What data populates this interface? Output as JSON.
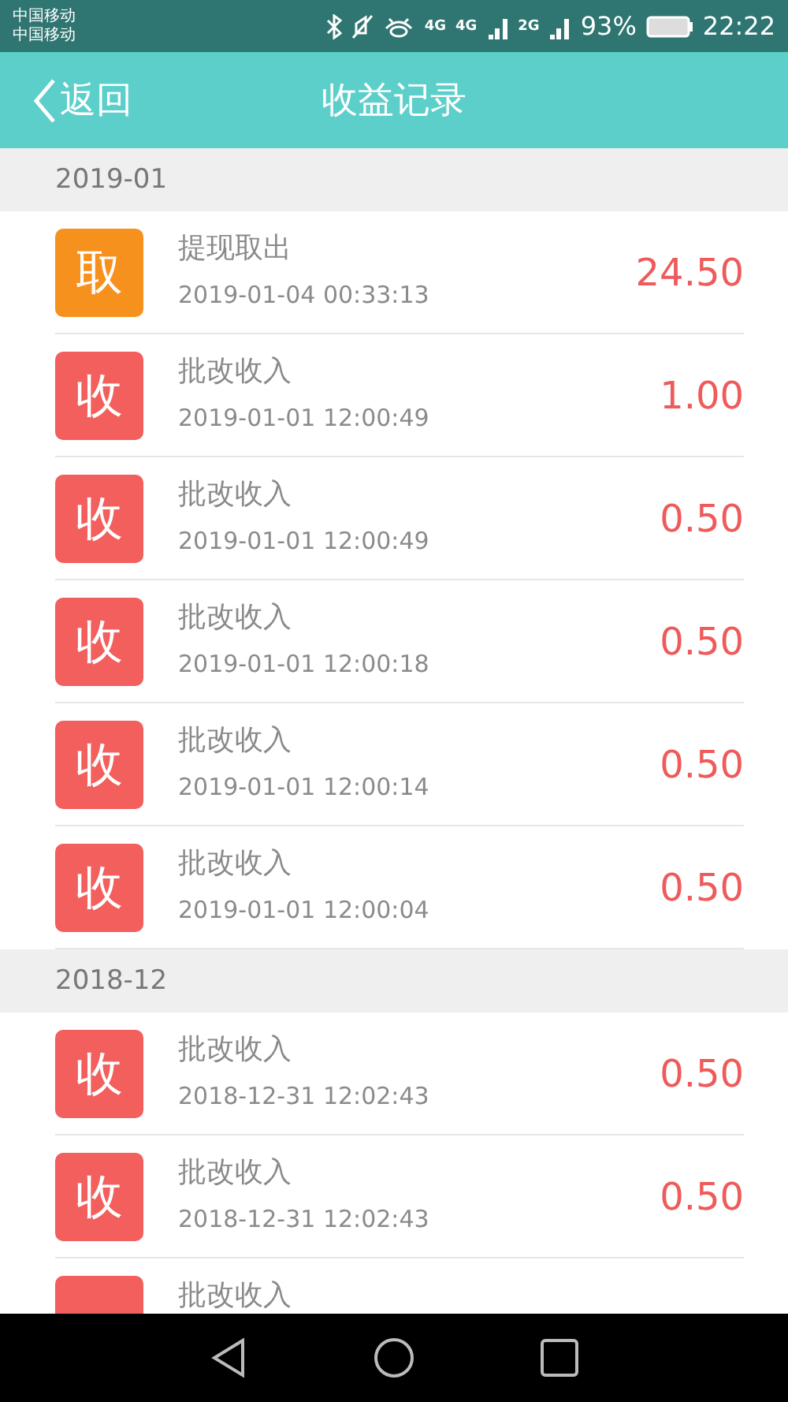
{
  "status_bar": {
    "carriers": [
      "中国移动",
      "中国移动"
    ],
    "network_labels": [
      "4G",
      "4G",
      "2G"
    ],
    "battery": "93%",
    "time": "22:22"
  },
  "header": {
    "back": "返回",
    "title": "收益记录"
  },
  "sections": [
    {
      "month": "2019-01",
      "records": [
        {
          "kind": "withdraw",
          "badge": "取",
          "title": "提现取出",
          "time": "2019-01-04 00:33:13",
          "amount": "24.50"
        },
        {
          "kind": "income",
          "badge": "收",
          "title": "批改收入",
          "time": "2019-01-01 12:00:49",
          "amount": "1.00"
        },
        {
          "kind": "income",
          "badge": "收",
          "title": "批改收入",
          "time": "2019-01-01 12:00:49",
          "amount": "0.50"
        },
        {
          "kind": "income",
          "badge": "收",
          "title": "批改收入",
          "time": "2019-01-01 12:00:18",
          "amount": "0.50"
        },
        {
          "kind": "income",
          "badge": "收",
          "title": "批改收入",
          "time": "2019-01-01 12:00:14",
          "amount": "0.50"
        },
        {
          "kind": "income",
          "badge": "收",
          "title": "批改收入",
          "time": "2019-01-01 12:00:04",
          "amount": "0.50"
        }
      ]
    },
    {
      "month": "2018-12",
      "records": [
        {
          "kind": "income",
          "badge": "收",
          "title": "批改收入",
          "time": "2018-12-31 12:02:43",
          "amount": "0.50"
        },
        {
          "kind": "income",
          "badge": "收",
          "title": "批改收入",
          "time": "2018-12-31 12:02:43",
          "amount": "0.50"
        },
        {
          "kind": "income",
          "title": "批改收入"
        }
      ]
    }
  ]
}
